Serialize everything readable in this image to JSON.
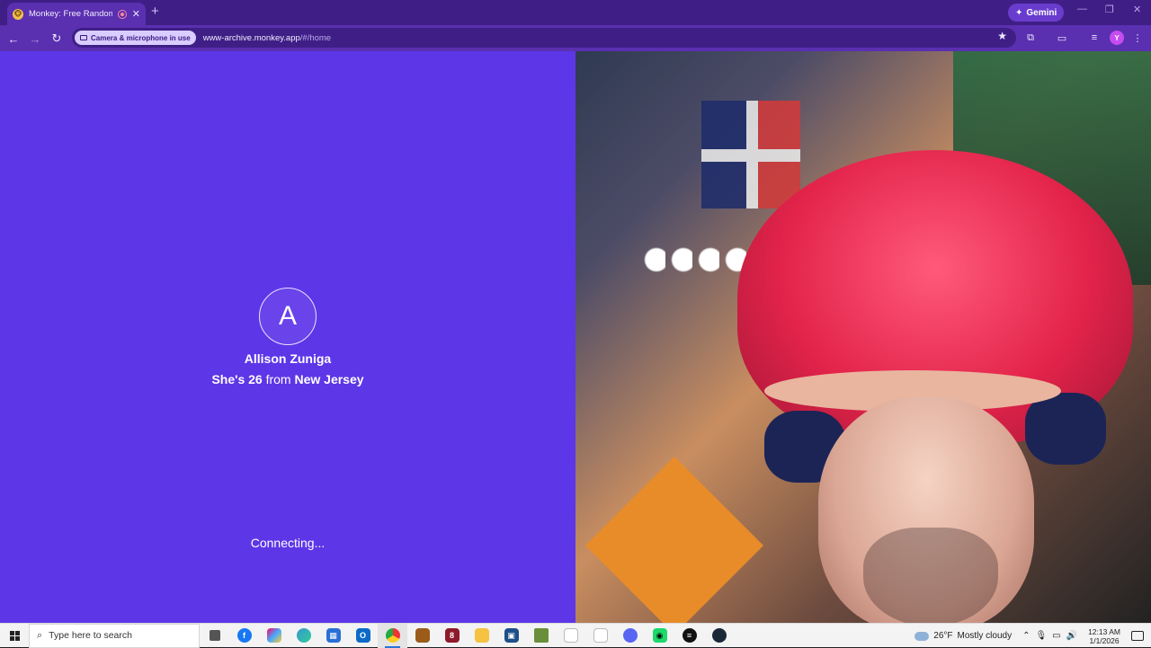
{
  "browser": {
    "tab_title": "Monkey: Free Random Video Chat",
    "new_tab_symbol": "+",
    "close_symbol": "✕",
    "gemini_label": "Gemini",
    "window_controls": [
      "—",
      "❐",
      "✕"
    ],
    "camera_chip": "Camera & microphone in use",
    "url_host": "www-archive.monkey.app",
    "url_path": "/#/home",
    "profile_initial": "Y"
  },
  "match": {
    "avatar_initial": "A",
    "name": "Allison Zuniga",
    "pronoun": "She's",
    "age": "26",
    "from_word": "from",
    "location": "New Jersey",
    "status": "Connecting..."
  },
  "taskbar": {
    "search_placeholder": "Type here to search",
    "weather_temp": "26°F",
    "weather_desc": "Mostly cloudy",
    "time": "12:13 AM",
    "date": "1/1/2026",
    "apps": [
      "task-view",
      "facebook",
      "copilot",
      "edge",
      "store",
      "outlook",
      "chrome",
      "app-brown",
      "app-red",
      "file-explorer",
      "app-blue",
      "minecraft",
      "file-1",
      "file-2",
      "discord",
      "app-green",
      "app-dark",
      "steam"
    ]
  },
  "colors": {
    "accent_purple": "#5d36e8",
    "chrome_dark": "#3f1f86",
    "chrome_mid": "#5a2fb0"
  }
}
